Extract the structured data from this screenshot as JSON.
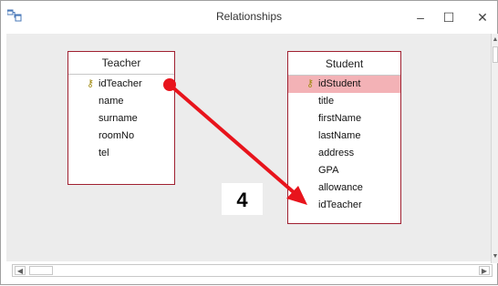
{
  "window": {
    "title": "Relationships",
    "minimize_glyph": "–",
    "maximize_glyph": "☐",
    "close_glyph": "✕"
  },
  "tables": {
    "teacher": {
      "name": "Teacher",
      "fields": [
        "idTeacher",
        "name",
        "surname",
        "roomNo",
        "tel"
      ],
      "primary_key": "idTeacher"
    },
    "student": {
      "name": "Student",
      "fields": [
        "idStudent",
        "title",
        "firstName",
        "lastName",
        "address",
        "GPA",
        "allowance",
        "idTeacher"
      ],
      "primary_key": "idStudent",
      "selected_field": "idStudent"
    }
  },
  "annotation": {
    "label": "4",
    "arrow_color": "#e8141c"
  },
  "icons": {
    "app": "relationships-icon",
    "key": "key-icon"
  }
}
